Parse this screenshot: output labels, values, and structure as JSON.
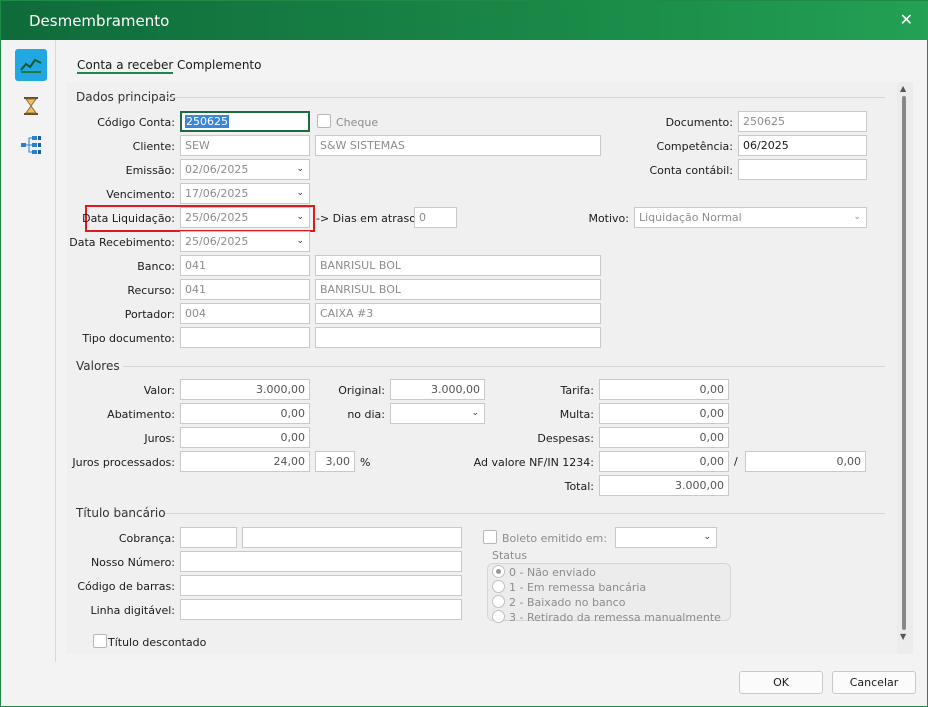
{
  "window": {
    "title": "Desmembramento"
  },
  "tabs": [
    "Conta a receber",
    "Complemento"
  ],
  "principais": {
    "title": "Dados principais",
    "codigo_label": "Código Conta:",
    "codigo_value": "250625",
    "cheque_label": "Cheque",
    "documento_label": "Documento:",
    "documento_value": "250625",
    "cliente_label": "Cliente:",
    "cliente_code": "SEW",
    "cliente_name": "S&W SISTEMAS",
    "competencia_label": "Competência:",
    "competencia_value": "06/2025",
    "emissao_label": "Emissão:",
    "emissao_value": "02/06/2025",
    "conta_contabil_label": "Conta contábil:",
    "conta_contabil_value": "",
    "vencimento_label": "Vencimento:",
    "vencimento_value": "17/06/2025",
    "liquidacao_label": "Data Liquidação:",
    "liquidacao_value": "25/06/2025",
    "dias_label": "-> Dias em atraso:",
    "dias_value": "0",
    "motivo_label": "Motivo:",
    "motivo_value": "Liquidação Normal",
    "recebimento_label": "Data Recebimento:",
    "recebimento_value": "25/06/2025",
    "banco_label": "Banco:",
    "banco_code": "041",
    "banco_name": "BANRISUL BOL",
    "recurso_label": "Recurso:",
    "recurso_code": "041",
    "recurso_name": "BANRISUL BOL",
    "portador_label": "Portador:",
    "portador_code": "004",
    "portador_name": "CAIXA #3",
    "tipo_label": "Tipo documento:",
    "tipo_code": "",
    "tipo_name": ""
  },
  "valores": {
    "title": "Valores",
    "valor_label": "Valor:",
    "valor_value": "3.000,00",
    "original_label": "Original:",
    "original_value": "3.000,00",
    "tarifa_label": "Tarifa:",
    "tarifa_value": "0,00",
    "abatimento_label": "Abatimento:",
    "abatimento_value": "0,00",
    "nodia_label": "no dia:",
    "nodia_value": "",
    "multa_label": "Multa:",
    "multa_value": "0,00",
    "juros_label": "Juros:",
    "juros_value": "0,00",
    "despesas_label": "Despesas:",
    "despesas_value": "0,00",
    "juros_proc_label": "Juros processados:",
    "juros_proc_value": "24,00",
    "juros_pct_value": "3,00",
    "pct_symbol": "%",
    "advalore_label": "Ad valore NF/IN 1234:",
    "advalore_value1": "0,00",
    "slash": "/",
    "advalore_value2": "0,00",
    "total_label": "Total:",
    "total_value": "3.000,00"
  },
  "titulo": {
    "title": "Título bancário",
    "cobranca_label": "Cobrança:",
    "cobranca_code": "",
    "cobranca_name": "",
    "boleto_label": "Boleto emitido em:",
    "boleto_value": "",
    "nosso_label": "Nosso Número:",
    "nosso_value": "",
    "status_label": "Status",
    "status_options": [
      "0 - Não enviado",
      "1 - Em remessa bancária",
      "2 - Baixado no banco",
      "3 - Retirado da remessa manualmente"
    ],
    "codbarras_label": "Código de barras:",
    "codbarras_value": "",
    "linha_label": "Linha digitável:",
    "linha_value": "",
    "descontado_label": "Título descontado"
  },
  "buttons": {
    "ok": "OK",
    "cancel": "Cancelar"
  },
  "colors": {
    "titlebar": "#1c8e4a",
    "highlight": "#e0191f",
    "accent": "#21a8e0"
  }
}
